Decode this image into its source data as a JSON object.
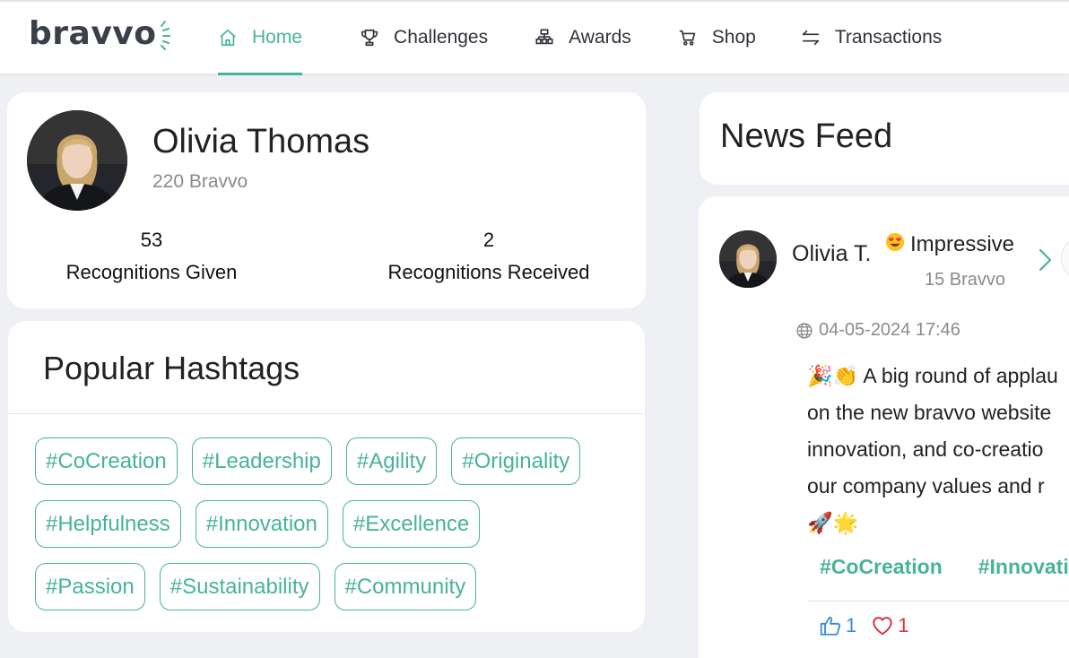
{
  "brand": {
    "name": "bravvo",
    "accent_color": "#47b39a"
  },
  "nav": {
    "items": [
      {
        "label": "Home",
        "icon": "home-icon",
        "active": true
      },
      {
        "label": "Challenges",
        "icon": "trophy-icon",
        "active": false
      },
      {
        "label": "Awards",
        "icon": "awards-icon",
        "active": false
      },
      {
        "label": "Shop",
        "icon": "cart-icon",
        "active": false
      },
      {
        "label": "Transactions",
        "icon": "transfer-icon",
        "active": false
      }
    ]
  },
  "profile": {
    "name": "Olivia Thomas",
    "points": "220 Bravvo",
    "given": {
      "count": "53",
      "label": "Recognitions Given"
    },
    "received": {
      "count": "2",
      "label": "Recognitions Received"
    }
  },
  "hashtags": {
    "title": "Popular Hashtags",
    "rows": [
      [
        "#CoCreation",
        "#Leadership",
        "#Agility",
        "#Originality"
      ],
      [
        "#Helpfulness",
        "#Innovation",
        "#Excellence"
      ],
      [
        "#Passion",
        "#Sustainability",
        "#Community"
      ]
    ]
  },
  "feed": {
    "title": "News Feed",
    "post": {
      "author": "Olivia T.",
      "badge": "Impressive",
      "badge_icon": "heart-eyes-emoji-icon",
      "bravvo": "15 Bravvo",
      "timestamp": "04-05-2024 17:46",
      "text_lines": [
        "🎉👏 A big round of applau",
        "on the new bravvo website",
        "innovation, and co-creatio",
        "our company values and r",
        "🚀🌟"
      ],
      "tags": [
        "#CoCreation",
        "#Innovatio"
      ],
      "likes": "1",
      "hearts": "1"
    }
  }
}
